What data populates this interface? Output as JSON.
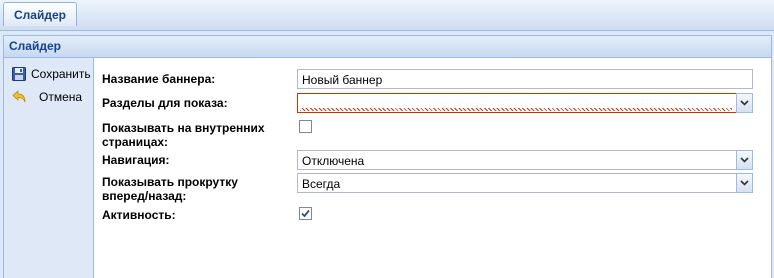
{
  "tabs": [
    {
      "label": "Слайдер"
    }
  ],
  "panel": {
    "title": "Слайдер"
  },
  "toolbar": {
    "save_label": "Сохранить",
    "cancel_label": "Отмена"
  },
  "form": {
    "banner_name": {
      "label": "Название баннера:",
      "value": "Новый баннер"
    },
    "sections": {
      "label": "Разделы для показа:",
      "value": ""
    },
    "show_inner": {
      "label": "Показывать на внутренних страницах:",
      "checked": false
    },
    "navigation": {
      "label": "Навигация:",
      "value": "Отключена"
    },
    "scroll": {
      "label": "Показывать прокрутку вперед/назад:",
      "value": "Всегда"
    },
    "active": {
      "label": "Активность:",
      "checked": true
    }
  },
  "colors": {
    "accent": "#15428b",
    "border": "#99bbe8",
    "invalid": "#cc3300"
  }
}
